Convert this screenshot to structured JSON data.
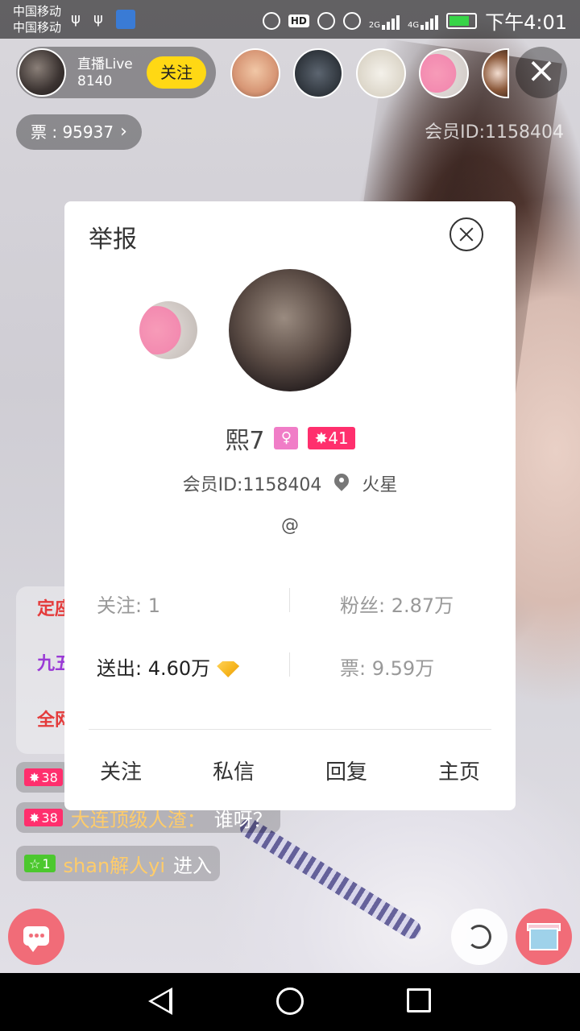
{
  "status_bar": {
    "carrier_1": "中国移动",
    "carrier_2": "中国移动",
    "network_2g": "2G",
    "network_4g": "4G",
    "time": "下午4:01"
  },
  "host": {
    "name": "直播Live",
    "room_id": "8140",
    "follow_label": "关注"
  },
  "tickets": {
    "label": "票 : 95937",
    "arrow": "›"
  },
  "top_member_id": "会员ID:1158404",
  "chat": {
    "panel_lines": [
      "定座",
      "九五",
      "全网"
    ],
    "messages": [
      {
        "level": "38",
        "user": "",
        "text": ""
      },
      {
        "level": "38",
        "user": "大连顶级人渣：",
        "text": "谁呀？"
      },
      {
        "level": "1",
        "user": "shan解人yi",
        "text": "进入"
      }
    ]
  },
  "modal": {
    "title": "举报",
    "nickname": "熙7",
    "level": "41",
    "member_id": "会员ID:1158404",
    "location": "火星",
    "signature": "@",
    "stats": {
      "following": "关注: 1",
      "fans": "粉丝: 2.87万",
      "sent": "送出: 4.60万",
      "tickets": "票: 9.59万"
    },
    "actions": [
      "关注",
      "私信",
      "回复",
      "主页"
    ]
  },
  "colors": {
    "follow_yellow": "#ffd814",
    "level_pink": "#ff2f6d",
    "female_pink": "#f07dc7",
    "chat_btn": "#f16c78"
  }
}
